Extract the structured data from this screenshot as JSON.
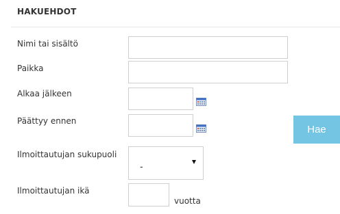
{
  "header": {
    "title": "HAKUEHDOT"
  },
  "fields": {
    "name": {
      "label": "Nimi tai sisältö",
      "value": ""
    },
    "place": {
      "label": "Paikka",
      "value": ""
    },
    "starts_after": {
      "label": "Alkaa jälkeen",
      "value": ""
    },
    "ends_before": {
      "label": "Päättyy ennen",
      "value": ""
    },
    "gender": {
      "label": "Ilmoittautujan sukupuoli",
      "selected": "-"
    },
    "age": {
      "label": "Ilmoittautujan ikä",
      "value": "",
      "unit": "vuotta"
    }
  },
  "actions": {
    "search_label": "Hae"
  },
  "icons": {
    "calendar": "calendar-icon",
    "dropdown": "caret-down-icon"
  },
  "colors": {
    "search_button": "#74c4e3",
    "input_border": "#cfcfcf",
    "divider": "#e6e6e6"
  }
}
